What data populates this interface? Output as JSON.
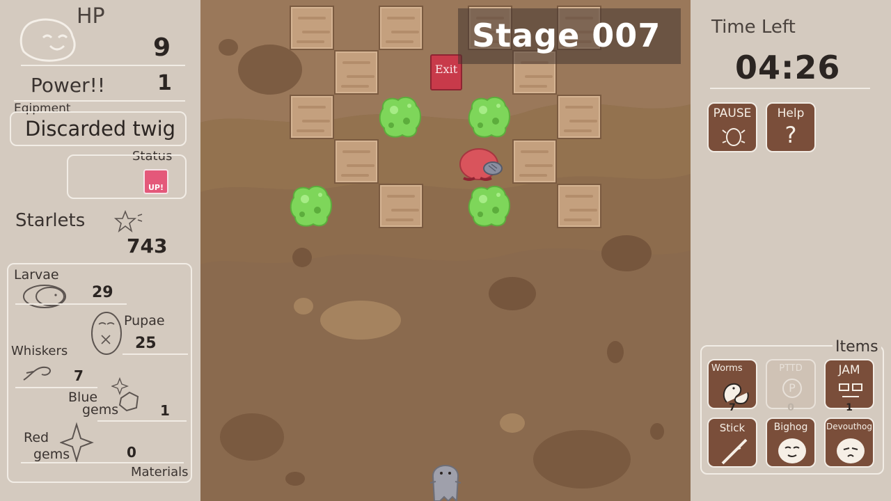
{
  "hud": {
    "hp_label": "HP",
    "hp_value": "9",
    "power_label": "Power!!",
    "power_value": "1",
    "equipment_label": "Eqipment",
    "equipment_value": "Discarded twig",
    "status_label": "Status",
    "status_badge": "UP!",
    "starlets_label": "Starlets",
    "starlets_value": "743"
  },
  "materials": {
    "title": "Materials",
    "larvae_label": "Larvae",
    "larvae_value": "29",
    "pupae_label": "Pupae",
    "pupae_value": "25",
    "whiskers_label": "Whiskers",
    "whiskers_value": "7",
    "blue_gems_label_1": "Blue",
    "blue_gems_label_2": "gems",
    "blue_gems_value": "1",
    "red_gems_label_1": "Red",
    "red_gems_label_2": "gems",
    "red_gems_value": "0"
  },
  "stage": {
    "title": "Stage 007",
    "exit_label": "Exit"
  },
  "timer": {
    "label": "Time Left",
    "value": "04:26"
  },
  "controls": {
    "pause_label": "PAUSE",
    "help_label": "Help"
  },
  "items": {
    "title": "Items",
    "list": [
      {
        "label": "Worms",
        "count": "7"
      },
      {
        "label": "PTTD",
        "count": "0"
      },
      {
        "label": "JAM",
        "count": "1"
      },
      {
        "label": "Stick",
        "count": ""
      },
      {
        "label": "Bighog",
        "count": ""
      },
      {
        "label": "Devouthog",
        "count": ""
      }
    ]
  },
  "colors": {
    "paper": "#d4cabf",
    "dirt": "#8b6b4f",
    "tile": "#c4a07e",
    "slime": "#7ed65a",
    "button": "#7a4e3a",
    "exit": "#c83a4a",
    "player": "#d9545c"
  }
}
